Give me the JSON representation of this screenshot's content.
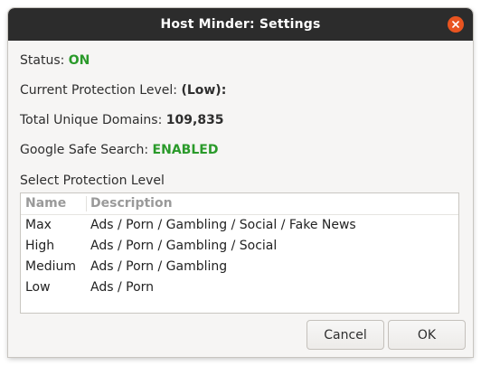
{
  "window": {
    "title": "Host Minder: Settings"
  },
  "status": {
    "label": "Status:",
    "value": "ON"
  },
  "protection": {
    "label": "Current Protection Level:",
    "value": "(Low):"
  },
  "domains": {
    "label": "Total Unique Domains:",
    "value": "109,835"
  },
  "safe_search": {
    "label": "Google Safe Search:",
    "value": "ENABLED"
  },
  "select_label": "Select Protection Level",
  "levels_table": {
    "columns": [
      "Name",
      "Description"
    ],
    "rows": [
      {
        "name": "Max",
        "description": "Ads / Porn / Gambling / Social / Fake News"
      },
      {
        "name": "High",
        "description": "Ads / Porn / Gambling / Social"
      },
      {
        "name": "Medium",
        "description": "Ads / Porn / Gambling"
      },
      {
        "name": "Low",
        "description": "Ads / Porn"
      }
    ]
  },
  "buttons": {
    "cancel": "Cancel",
    "ok": "OK"
  },
  "colors": {
    "titlebar": "#2c2c2c",
    "close_button": "#e95420",
    "enabled_green": "#2a9a2a"
  },
  "icons": {
    "close": "close-icon"
  }
}
